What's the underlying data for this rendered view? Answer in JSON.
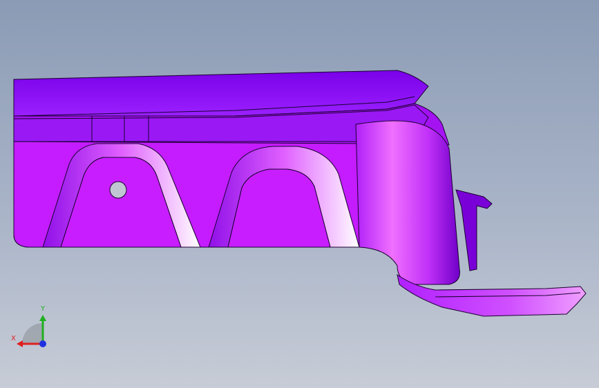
{
  "viewport": {
    "background_top": "#8b9bb5",
    "background_bottom": "#c7ccd6",
    "part_color": "#8a10f0",
    "edge_color": "#1a0030"
  },
  "triad": {
    "x_label": "X",
    "y_label": "Y",
    "x_color": "#e02020",
    "y_color": "#20b020",
    "z_color": "#2030e0"
  }
}
